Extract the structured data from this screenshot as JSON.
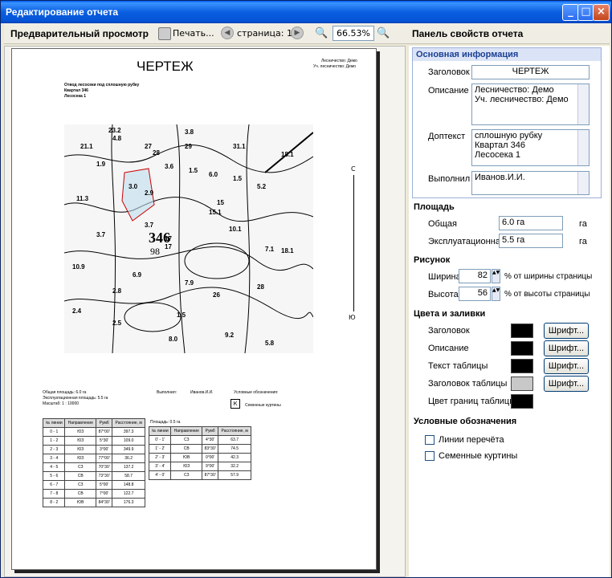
{
  "window": {
    "title": "Редактирование отчета"
  },
  "toolbar": {
    "preview_label": "Предварительный просмотр",
    "print_label": "Печать...",
    "page_label": "страница: 1/1",
    "zoom_value": "66.53%",
    "panel_title": "Панель свойств отчета"
  },
  "report": {
    "title": "ЧЕРТЕЖ",
    "forestry": "Лесничество: Демо",
    "district": "Уч. лесничество: Демо",
    "subtitle1": "Отвод лесосеки под сплошную рубку",
    "subtitle2": "Квартал 346",
    "subtitle3": "Лесосека 1",
    "total_area": "Общая площадь: 6.0 га",
    "exp_area": "Эксплуатационная площадь: 5.5 га",
    "scale": "Масштаб: 1 : 10000",
    "performed": "Выполнил:",
    "performer": "Иванов.И.И.",
    "legend_title": "Условные обозначения:",
    "legend_symbol": "К",
    "legend_seed": "Семенные куртины",
    "area2": "Площадь: 0.5 га",
    "north": "С",
    "south": "Ю",
    "big_number": "346",
    "big_sub": "98",
    "table1": {
      "headers": [
        "№ линии",
        "Направление",
        "Румб",
        "Расстояние, м"
      ],
      "rows": [
        [
          "0 - 1",
          "ЮЗ",
          "87°00'",
          "397.3"
        ],
        [
          "1 - 2",
          "ЮЗ",
          "5°30'",
          "109.0"
        ],
        [
          "2 - 3",
          "ЮЗ",
          "3°00'",
          "349.9"
        ],
        [
          "3 - 4",
          "ЮЗ",
          "77°00'",
          "36.2"
        ],
        [
          "4 - 5",
          "СЗ",
          "70°30'",
          "137.2"
        ],
        [
          "5 - 6",
          "СВ",
          "73°30'",
          "58.7"
        ],
        [
          "6 - 7",
          "СЗ",
          "5°00'",
          "148.8"
        ],
        [
          "7 - 8",
          "СВ",
          "7°00'",
          "122.7"
        ],
        [
          "8 - 2",
          "ЮВ",
          "84°30'",
          "176.3"
        ]
      ]
    },
    "table2": {
      "headers": [
        "№ линии",
        "Направление",
        "Румб",
        "Расстояние, м"
      ],
      "rows": [
        [
          "0' - 1'",
          "СЗ",
          "4°30'",
          "63.7"
        ],
        [
          "1' - 2'",
          "СВ",
          "83°30'",
          "74.5"
        ],
        [
          "2' - 3'",
          "ЮВ",
          "0°00'",
          "42.3"
        ],
        [
          "3' - 4'",
          "ЮЗ",
          "9°00'",
          "32.2"
        ],
        [
          "4' - 0'",
          "СЗ",
          "87°30'",
          "57.9"
        ]
      ]
    }
  },
  "panel": {
    "basic": "Основная информация",
    "header_label": "Заголовок",
    "header_value": "ЧЕРТЕЖ",
    "desc_label": "Описание",
    "desc_value": "Лесничество: Демо\nУч. лесничество: Демо",
    "extra_label": "Доптекст",
    "extra_value": "сплошную рубку\nКвартал 346\nЛесосека 1",
    "performer_label": "Выполнил",
    "performer_value": "Иванов.И.И.",
    "area_section": "Площадь",
    "total_label": "Общая",
    "total_value": "6.0 га",
    "total_unit": "га",
    "exp_label": "Эксплуатационная",
    "exp_value": "5.5 га",
    "exp_unit": "га",
    "drawing_section": "Рисунок",
    "width_label": "Ширина",
    "width_value": "82",
    "width_note": "% от ширины страницы",
    "height_label": "Высота",
    "height_value": "56",
    "height_note": "% от высоты страницы",
    "colors_section": "Цвета и заливки",
    "color_rows": [
      {
        "label": "Заголовок",
        "color": "#000000",
        "button": "Шрифт..."
      },
      {
        "label": "Описание",
        "color": "#000000",
        "button": "Шрифт..."
      },
      {
        "label": "Текст таблицы",
        "color": "#000000",
        "button": "Шрифт..."
      },
      {
        "label": "Заголовок таблицы",
        "color": "#c8c8c8",
        "button": "Шрифт..."
      },
      {
        "label": "Цвет границ таблицы",
        "color": "#000000",
        "button": ""
      }
    ],
    "legend_section": "Условные обозначения",
    "check1": "Линии перечёта",
    "check2": "Семенные куртины"
  }
}
